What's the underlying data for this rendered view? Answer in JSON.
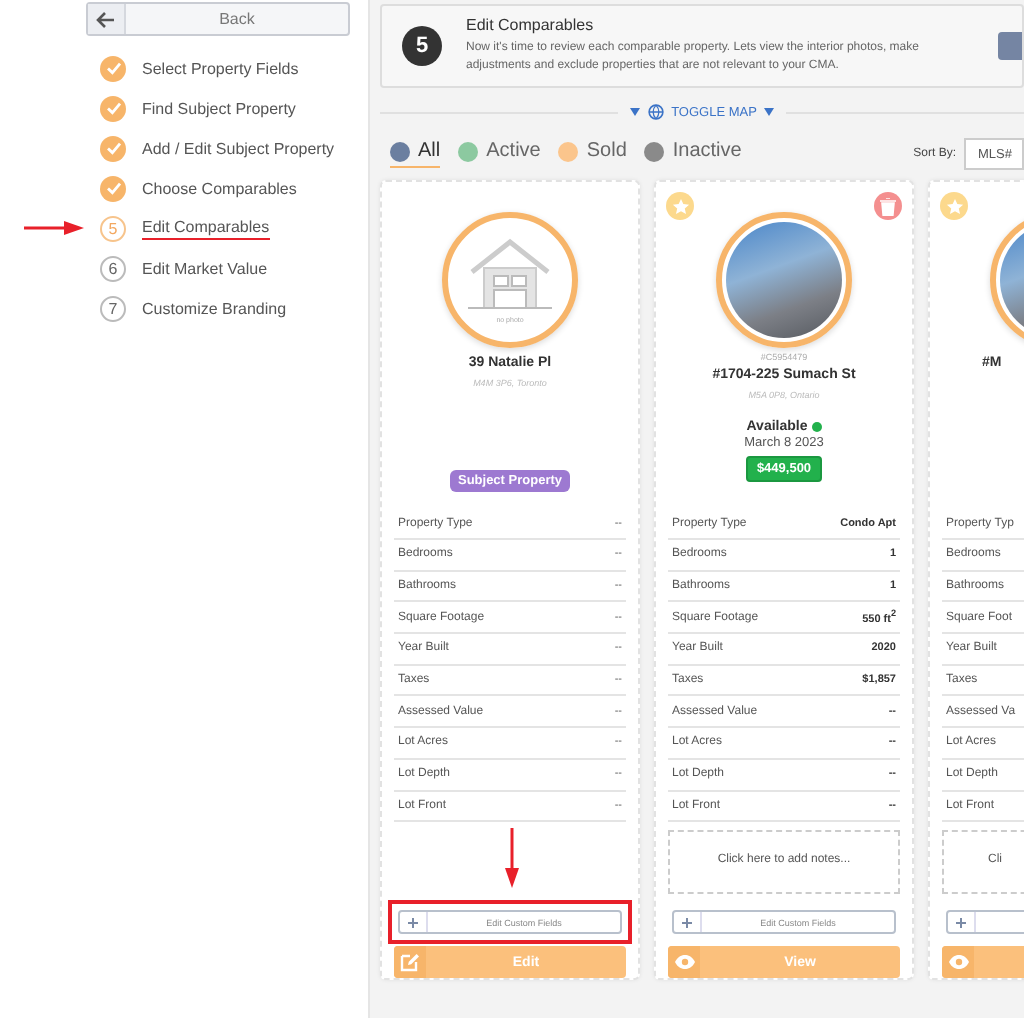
{
  "sidebar": {
    "back_label": "Back",
    "steps": [
      {
        "label": "Select Property Fields",
        "completed": true,
        "selected": false
      },
      {
        "label": "Find Subject Property",
        "completed": true,
        "selected": false
      },
      {
        "label": "Add / Edit Subject Property",
        "completed": true,
        "selected": false
      },
      {
        "label": "Choose Comparables",
        "completed": true,
        "selected": false
      },
      {
        "number": "5",
        "label": "Edit Comparables",
        "completed": false,
        "selected": true
      },
      {
        "number": "6",
        "label": "Edit Market Value",
        "completed": false,
        "selected": false
      },
      {
        "number": "7",
        "label": "Customize Branding",
        "completed": false,
        "selected": false
      }
    ]
  },
  "header": {
    "step": "5",
    "title": "Edit Comparables",
    "description": "Now it's time to review each comparable property. Lets view the interior photos, make adjustments and exclude properties that are not relevant to your CMA."
  },
  "toggle_map": "TOGGLE MAP",
  "filters": [
    {
      "label": "All",
      "color": "#6b7fa0",
      "selected": true
    },
    {
      "label": "Active",
      "color": "#8cc9a0",
      "selected": false
    },
    {
      "label": "Sold",
      "color": "#fbc58c",
      "selected": false
    },
    {
      "label": "Inactive",
      "color": "#8a8a8a",
      "selected": false
    }
  ],
  "sort": {
    "label": "Sort By:",
    "value": "MLS#"
  },
  "cards": [
    {
      "kind": "subject",
      "photo": {
        "kind": "house"
      },
      "photo_caption": "no photo",
      "title": "39 Natalie Pl",
      "address": "M4M 3P6, Toronto",
      "badge": "Subject Property",
      "rows": [
        {
          "label": "Property Type",
          "value": "--"
        },
        {
          "label": "Bedrooms",
          "value": "--"
        },
        {
          "label": "Bathrooms",
          "value": "--"
        },
        {
          "label": "Square Footage",
          "value": "--"
        },
        {
          "label": "Year Built",
          "value": "--"
        },
        {
          "label": "Taxes",
          "value": "--"
        },
        {
          "label": "Assessed Value",
          "value": "--"
        },
        {
          "label": "Lot Acres",
          "value": "--"
        },
        {
          "label": "Lot Depth",
          "value": "--"
        },
        {
          "label": "Lot Front",
          "value": "--"
        }
      ],
      "custom_fields": "Edit Custom Fields",
      "action": {
        "kind": "edit",
        "label": "Edit"
      }
    },
    {
      "kind": "comparable",
      "starred": false,
      "deletable": true,
      "photo": {
        "kind": "photo"
      },
      "mls": "#C5954479",
      "title": "#1704-225 Sumach St",
      "address": "M5A 0P8, Ontario",
      "status": {
        "label": "Available",
        "color": "#22b14c"
      },
      "date": "March 8 2023",
      "price": "$449,500",
      "rows": [
        {
          "label": "Property Type",
          "value": "Condo Apt"
        },
        {
          "label": "Bedrooms",
          "value": "1"
        },
        {
          "label": "Bathrooms",
          "value": "1"
        },
        {
          "label": "Square Footage",
          "value": "550 ft$^{2}$"
        },
        {
          "label": "Year Built",
          "value": "2020"
        },
        {
          "label": "Taxes",
          "value": "$1,857"
        },
        {
          "label": "Assessed Value",
          "value": "--"
        },
        {
          "label": "Lot Acres",
          "value": "--"
        },
        {
          "label": "Lot Depth",
          "value": "--"
        },
        {
          "label": "Lot Front",
          "value": "--"
        }
      ],
      "notes": "Click here to add notes...",
      "custom_fields": "Edit Custom Fields",
      "action": {
        "kind": "view",
        "label": "View"
      }
    },
    {
      "kind": "comparable",
      "starred": false,
      "photo": {
        "kind": "photo"
      },
      "title": "#M",
      "rows": [
        {
          "label": "Property Typ"
        },
        {
          "label": "Bedrooms"
        },
        {
          "label": "Bathrooms"
        },
        {
          "label": "Square Foot"
        },
        {
          "label": "Year Built"
        },
        {
          "label": "Taxes"
        },
        {
          "label": "Assessed Va"
        },
        {
          "label": "Lot Acres"
        },
        {
          "label": "Lot Depth"
        },
        {
          "label": "Lot Front"
        }
      ],
      "notes": "Cli",
      "action": {
        "kind": "view"
      }
    }
  ]
}
